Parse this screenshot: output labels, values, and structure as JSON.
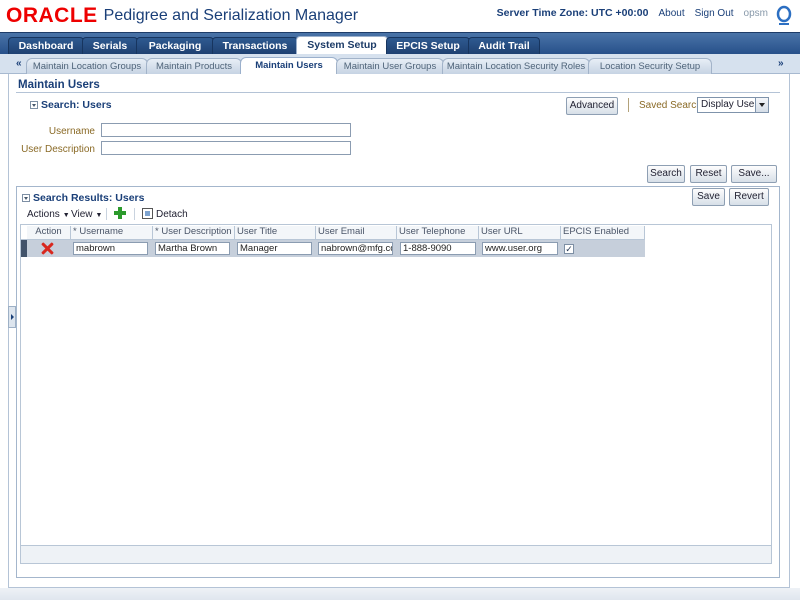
{
  "header": {
    "logo_text": "ORACLE",
    "app_title": "Pedigree and Serialization Manager",
    "server_time_zone": "Server Time Zone: UTC +00:00",
    "about_link": "About",
    "sign_out_link": "Sign Out",
    "user_name": "opsm"
  },
  "tabs": [
    {
      "label": "Dashboard",
      "active": false
    },
    {
      "label": "Serials",
      "active": false
    },
    {
      "label": "Packaging",
      "active": false
    },
    {
      "label": "Transactions",
      "active": false
    },
    {
      "label": "System Setup",
      "active": true
    },
    {
      "label": "EPCIS Setup",
      "active": false
    },
    {
      "label": "Audit Trail",
      "active": false
    }
  ],
  "subtabs": [
    {
      "label": "Maintain Location Groups",
      "active": false
    },
    {
      "label": "Maintain Products",
      "active": false
    },
    {
      "label": "Maintain Users",
      "active": true
    },
    {
      "label": "Maintain User Groups",
      "active": false
    },
    {
      "label": "Maintain Location Security Roles",
      "active": false
    },
    {
      "label": "Location Security Setup",
      "active": false
    }
  ],
  "scroll": {
    "left": "«",
    "right": "»"
  },
  "page": {
    "title": "Maintain Users"
  },
  "search": {
    "header": "Search: Users",
    "advanced_button": "Advanced",
    "saved_search_label": "Saved Search",
    "saved_search_value": "Display Users",
    "fields": [
      {
        "label": "Username",
        "value": ""
      },
      {
        "label": "User Description",
        "value": ""
      }
    ],
    "buttons": {
      "search": "Search",
      "reset": "Reset",
      "save": "Save..."
    }
  },
  "results": {
    "header": "Search Results: Users",
    "save_button": "Save",
    "revert_button": "Revert",
    "toolbar": {
      "actions": "Actions",
      "view": "View",
      "detach": "Detach"
    },
    "columns": [
      "Action",
      "* Username",
      "* User Description",
      "User Title",
      "User Email",
      "User Telephone",
      "User URL",
      "EPCIS Enabled"
    ],
    "rows": [
      {
        "username": "mabrown",
        "description": "Martha Brown",
        "title": "Manager",
        "email": "nabrown@mfg.com",
        "telephone": "1-888-9090",
        "url": "www.user.org",
        "epcis_enabled": true
      }
    ]
  },
  "icons": {
    "delete": "delete-x-icon",
    "add": "add-plus-icon",
    "detach": "detach-icon",
    "disclosure": "disclosure-triangle-icon"
  },
  "colors": {
    "brand_red": "#ee0000",
    "navy": "#1a3f78",
    "tab_bar": "#27508a",
    "label_brown": "#8a6a26"
  }
}
